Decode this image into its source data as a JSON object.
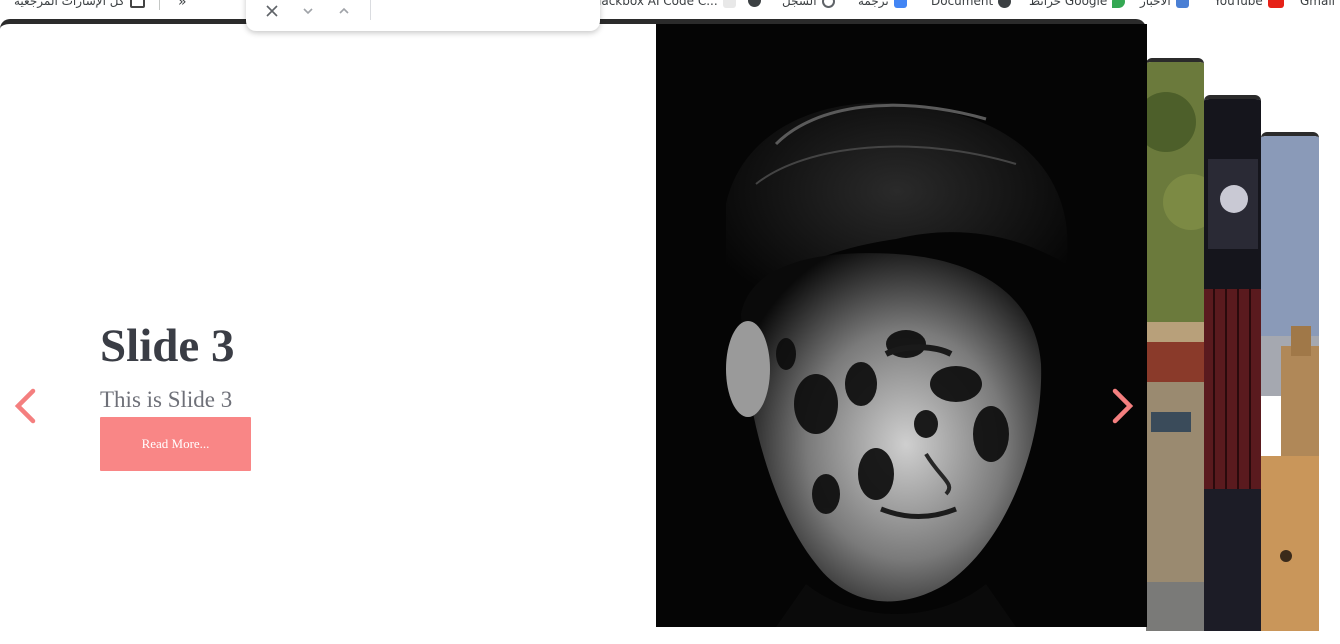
{
  "bookmarks": {
    "all_bookmarks": "كل الإشارات المرجعية",
    "blackbox": "lackbox AI Code C...",
    "history": "السجل",
    "translate": "ترجمة",
    "document": "Document",
    "maps": "خرائط Google",
    "news": "الأخبار",
    "youtube": "YouTube",
    "gmail": "Gmail"
  },
  "find_bar": {
    "close_icon": "close-icon",
    "next_icon": "chevron-down-icon",
    "prev_icon": "chevron-up-icon"
  },
  "slider": {
    "title": "Slide 3",
    "subtitle": "This is Slide 3",
    "button_label": "Read More...",
    "accent_color": "#f98686",
    "prev_icon": "chevron-left-icon",
    "next_icon": "chevron-right-icon"
  }
}
